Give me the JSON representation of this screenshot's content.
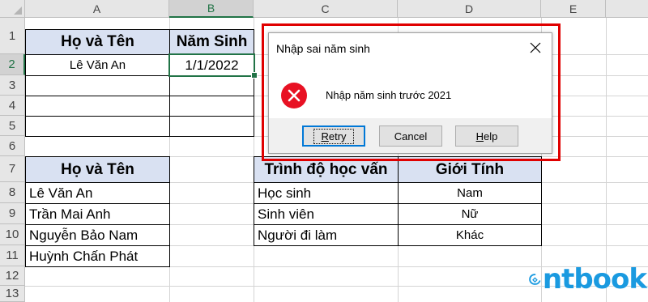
{
  "columns": [
    "A",
    "B",
    "C",
    "D",
    "E"
  ],
  "rows": [
    "1",
    "2",
    "3",
    "4",
    "5",
    "6",
    "7",
    "8",
    "9",
    "10",
    "11",
    "12",
    "13"
  ],
  "table1": {
    "headers": [
      "Họ và Tên",
      "Năm Sinh"
    ],
    "row1": [
      "Lê Văn An",
      "1/1/2022"
    ]
  },
  "list_names": {
    "header": "Họ và Tên",
    "items": [
      "Lê Văn An",
      "Trần Mai Anh",
      "Nguyễn Bảo Nam",
      "Huỳnh Chấn Phát"
    ]
  },
  "table2": {
    "headers": [
      "Trình độ học vấn",
      "Giới Tính"
    ],
    "col1": [
      "Học sinh",
      "Sinh viên",
      "Người đi làm"
    ],
    "col2": [
      "Nam",
      "Nữ",
      "Khác"
    ]
  },
  "dialog": {
    "title": "Nhập sai năm sinh",
    "message": "Nhập năm sinh trước 2021",
    "buttons": {
      "retry_first": "R",
      "retry_rest": "etry",
      "cancel": "Cancel",
      "help_first": "H",
      "help_rest": "elp"
    },
    "icon": "error-icon",
    "close_icon": "close-icon"
  },
  "colors": {
    "header_fill": "#d9e1f2",
    "accent": "#217346",
    "highlight": "#e00000",
    "logo": "#1a9ae0"
  },
  "logo": {
    "text": "ntbook"
  }
}
